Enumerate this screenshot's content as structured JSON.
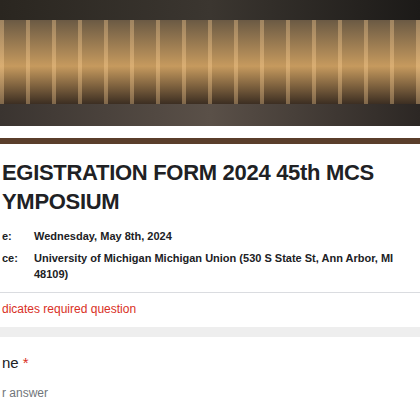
{
  "form": {
    "title_lines": [
      "EGISTRATION FORM 2024 45th MCS",
      "YMPOSIUM"
    ],
    "details": [
      {
        "label": "e:",
        "value": "Wednesday, May 8th, 2024"
      },
      {
        "label": "ce:",
        "value": "University of Michigan Michigan Union (530 S State St, Ann Arbor, MI 48109)"
      }
    ],
    "required_note": "dicates required question"
  },
  "questions": [
    {
      "label": "ne",
      "required_mark": "*",
      "placeholder": "r answer"
    }
  ]
}
